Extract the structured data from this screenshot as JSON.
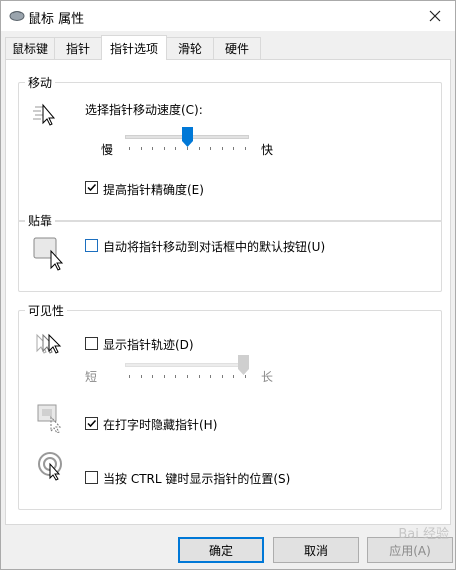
{
  "window": {
    "title": "鼠标 属性"
  },
  "tabs": [
    "鼠标键",
    "指针",
    "指针选项",
    "滑轮",
    "硬件"
  ],
  "active_tab": 2,
  "motion": {
    "group_label": "移动",
    "speed_label": "选择指针移动速度(C):",
    "slow_label": "慢",
    "fast_label": "快",
    "speed_level": 0.5,
    "precision_label": "提高指针精确度(E)",
    "precision_checked": true
  },
  "snap": {
    "group_label": "贴靠",
    "snap_label": "自动将指针移动到对话框中的默认按钮(U)",
    "snap_checked": false
  },
  "visibility": {
    "group_label": "可见性",
    "trails_label": "显示指针轨迹(D)",
    "trails_checked": false,
    "short_label": "短",
    "long_label": "长",
    "trails_level": 1.0,
    "hide_label": "在打字时隐藏指针(H)",
    "hide_checked": true,
    "ctrl_label": "当按 CTRL 键时显示指针的位置(S)",
    "ctrl_checked": false
  },
  "buttons": {
    "ok": "确定",
    "cancel": "取消",
    "apply": "应用(A)"
  },
  "watermark": "Bai 经验",
  "colors": {
    "accent": "#0078d7",
    "annotation_arrow": "#e8403a",
    "check_blue": "#1c6fbf"
  }
}
